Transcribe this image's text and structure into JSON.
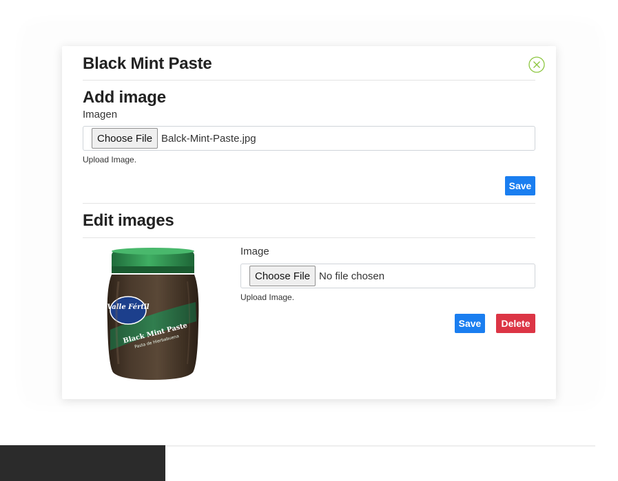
{
  "modal": {
    "title": "Black Mint Paste"
  },
  "add_image": {
    "heading": "Add image",
    "field_label": "Imagen",
    "choose_file_label": "Choose File",
    "file_name": "Balck-Mint-Paste.jpg",
    "help_text": "Upload Image.",
    "save_label": "Save"
  },
  "edit_images": {
    "heading": "Edit images",
    "items": [
      {
        "product_label_brand": "Valle Fértil",
        "product_label_name": "Black Mint Paste",
        "product_label_sub": "Pasta de Hierbabuena",
        "field_label": "Image",
        "choose_file_label": "Choose File",
        "file_name": "No file chosen",
        "help_text": "Upload Image.",
        "save_label": "Save",
        "delete_label": "Delete"
      }
    ]
  },
  "colors": {
    "primary": "#1a7ef0",
    "danger": "#dc3545",
    "close_icon": "#8cc63f"
  }
}
